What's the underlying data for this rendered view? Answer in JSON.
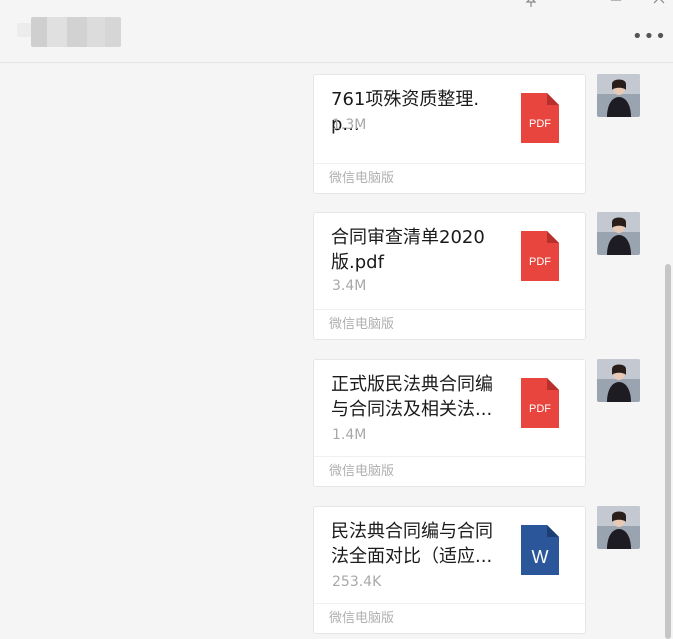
{
  "window": {
    "pin_icon": "pin-icon",
    "minimize_icon": "minimize-icon",
    "maximize_icon": "maximize-icon",
    "close_icon": "close-icon",
    "more_label": "•••"
  },
  "colors": {
    "pdf_red": "#e9453f",
    "word_blue": "#2b579a",
    "background": "#f5f5f5",
    "card": "#ffffff"
  },
  "messages": [
    {
      "file_name": "761项殊资质整理.p...",
      "size": "1.3M",
      "type_label": "PDF",
      "source": "微信电脑版"
    },
    {
      "file_name": "合同审查清单2020\n版.pdf",
      "size": "3.4M",
      "type_label": "PDF",
      "source": "微信电脑版"
    },
    {
      "file_name": "正式版民法典合同编\n与合同法及相关法...",
      "size": "1.4M",
      "type_label": "PDF",
      "source": "微信电脑版"
    },
    {
      "file_name": "民法典合同编与合同\n法全面对比（适应...",
      "size": "253.4K",
      "type_label": "W",
      "source": "微信电脑版"
    }
  ]
}
